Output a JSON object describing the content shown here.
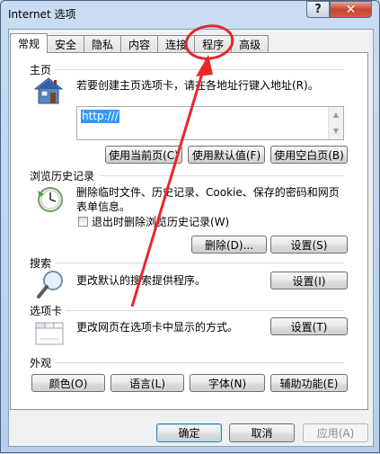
{
  "window": {
    "title": "Internet 选项",
    "help_glyph": "?",
    "close_glyph": "✕"
  },
  "tabs": [
    "常规",
    "安全",
    "隐私",
    "内容",
    "连接",
    "程序",
    "高级"
  ],
  "home": {
    "label": "主页",
    "description": "若要创建主页选项卡，请在各地址行键入地址(R)。",
    "url": "http:///",
    "buttons": [
      "使用当前页(C)",
      "使用默认值(F)",
      "使用空白页(B)"
    ]
  },
  "history": {
    "label": "浏览历史记录",
    "description": "删除临时文件、历史记录、Cookie、保存的密码和网页表单信息。",
    "checkbox_label": "退出时删除浏览历史记录(W)",
    "delete_button": "删除(D)...",
    "settings_button": "设置(S)"
  },
  "search": {
    "label": "搜索",
    "description": "更改默认的搜索提供程序。",
    "settings_button": "设置(I)"
  },
  "tabs_section": {
    "label": "选项卡",
    "description": "更改网页在选项卡中显示的方式。",
    "settings_button": "设置(T)"
  },
  "appearance": {
    "label": "外观",
    "buttons": [
      "颜色(O)",
      "语言(L)",
      "字体(N)",
      "辅助功能(E)"
    ]
  },
  "footer": {
    "ok": "确定",
    "cancel": "取消",
    "apply": "应用(A)"
  },
  "annotation_color": "#e8272b"
}
